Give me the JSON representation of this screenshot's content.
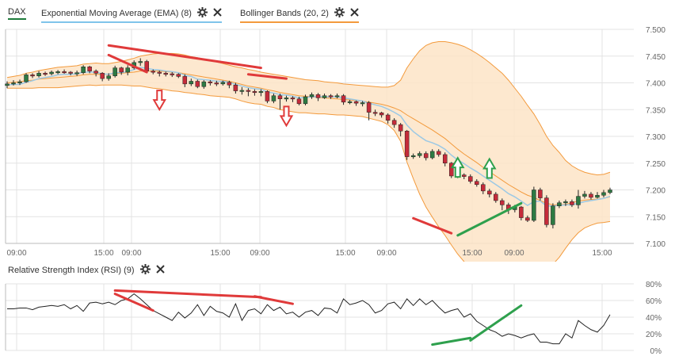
{
  "chart_data": [
    {
      "type": "candlestick",
      "instrument": "DAX",
      "y_ticks": [
        "7.500",
        "7.450",
        "7.400",
        "7.350",
        "7.300",
        "7.250",
        "7.200",
        "7.150",
        "7.100"
      ],
      "ylim": [
        7100,
        7500
      ],
      "x_ticks": [
        "09:00",
        "15:00",
        "09:00",
        "15:00",
        "09:00",
        "15:00",
        "09:00",
        "15:00",
        "09:00",
        "15:00"
      ],
      "grid": true,
      "legend": [
        {
          "label": "DAX",
          "color": "#1e7b3c"
        },
        {
          "label": "Exponential Moving Average (EMA) (8)",
          "color": "#7fc4ea"
        },
        {
          "label": "Bollinger Bands (20, 2)",
          "color": "#f39a3c"
        }
      ],
      "candles": [
        [
          7395,
          7398,
          7390,
          7403
        ],
        [
          7398,
          7400,
          7395,
          7405
        ],
        [
          7400,
          7402,
          7396,
          7406
        ],
        [
          7402,
          7415,
          7400,
          7418
        ],
        [
          7415,
          7413,
          7409,
          7418
        ],
        [
          7413,
          7418,
          7410,
          7422
        ],
        [
          7418,
          7417,
          7413,
          7421
        ],
        [
          7417,
          7420,
          7414,
          7423
        ],
        [
          7420,
          7421,
          7416,
          7424
        ],
        [
          7421,
          7420,
          7417,
          7425
        ],
        [
          7420,
          7418,
          7414,
          7422
        ],
        [
          7418,
          7419,
          7413,
          7423
        ],
        [
          7419,
          7430,
          7416,
          7433
        ],
        [
          7430,
          7422,
          7418,
          7432
        ],
        [
          7422,
          7418,
          7412,
          7425
        ],
        [
          7418,
          7408,
          7403,
          7420
        ],
        [
          7408,
          7413,
          7404,
          7418
        ],
        [
          7413,
          7428,
          7410,
          7432
        ],
        [
          7428,
          7420,
          7415,
          7430
        ],
        [
          7420,
          7428,
          7414,
          7433
        ],
        [
          7428,
          7438,
          7425,
          7442
        ],
        [
          7438,
          7440,
          7432,
          7446
        ],
        [
          7440,
          7422,
          7418,
          7443
        ],
        [
          7422,
          7420,
          7416,
          7425
        ],
        [
          7420,
          7418,
          7412,
          7423
        ],
        [
          7418,
          7417,
          7412,
          7421
        ],
        [
          7417,
          7416,
          7411,
          7420
        ],
        [
          7416,
          7412,
          7409,
          7418
        ],
        [
          7412,
          7398,
          7392,
          7416
        ],
        [
          7398,
          7403,
          7394,
          7408
        ],
        [
          7403,
          7393,
          7390,
          7406
        ],
        [
          7393,
          7402,
          7389,
          7405
        ],
        [
          7402,
          7400,
          7395,
          7405
        ],
        [
          7400,
          7398,
          7394,
          7404
        ],
        [
          7398,
          7401,
          7395,
          7404
        ],
        [
          7401,
          7396,
          7390,
          7404
        ],
        [
          7396,
          7385,
          7380,
          7400
        ],
        [
          7385,
          7386,
          7378,
          7392
        ],
        [
          7386,
          7384,
          7375,
          7390
        ],
        [
          7384,
          7382,
          7376,
          7388
        ],
        [
          7382,
          7384,
          7375,
          7388
        ],
        [
          7384,
          7366,
          7362,
          7386
        ],
        [
          7366,
          7376,
          7362,
          7380
        ],
        [
          7376,
          7370,
          7350,
          7380
        ],
        [
          7370,
          7372,
          7365,
          7376
        ],
        [
          7372,
          7370,
          7364,
          7375
        ],
        [
          7370,
          7361,
          7358,
          7374
        ],
        [
          7361,
          7374,
          7358,
          7378
        ],
        [
          7374,
          7378,
          7370,
          7382
        ],
        [
          7378,
          7372,
          7366,
          7381
        ],
        [
          7372,
          7376,
          7370,
          7380
        ],
        [
          7376,
          7375,
          7370,
          7379
        ],
        [
          7375,
          7376,
          7371,
          7380
        ],
        [
          7376,
          7364,
          7359,
          7379
        ],
        [
          7364,
          7365,
          7360,
          7368
        ],
        [
          7365,
          7362,
          7357,
          7367
        ],
        [
          7362,
          7363,
          7356,
          7366
        ],
        [
          7363,
          7345,
          7330,
          7366
        ],
        [
          7345,
          7344,
          7338,
          7350
        ],
        [
          7344,
          7340,
          7335,
          7346
        ],
        [
          7340,
          7330,
          7324,
          7343
        ],
        [
          7330,
          7322,
          7316,
          7334
        ],
        [
          7322,
          7310,
          7300,
          7325
        ],
        [
          7310,
          7262,
          7256,
          7312
        ],
        [
          7262,
          7264,
          7258,
          7268
        ],
        [
          7264,
          7268,
          7260,
          7272
        ],
        [
          7268,
          7260,
          7255,
          7272
        ],
        [
          7260,
          7272,
          7257,
          7276
        ],
        [
          7272,
          7266,
          7262,
          7276
        ],
        [
          7266,
          7250,
          7244,
          7270
        ],
        [
          7250,
          7226,
          7222,
          7252
        ],
        [
          7226,
          7228,
          7222,
          7232
        ],
        [
          7228,
          7225,
          7220,
          7231
        ],
        [
          7225,
          7216,
          7212,
          7229
        ],
        [
          7216,
          7210,
          7206,
          7220
        ],
        [
          7210,
          7198,
          7192,
          7214
        ],
        [
          7198,
          7192,
          7186,
          7202
        ],
        [
          7192,
          7180,
          7176,
          7196
        ],
        [
          7180,
          7172,
          7162,
          7184
        ],
        [
          7172,
          7163,
          7155,
          7176
        ],
        [
          7163,
          7168,
          7158,
          7172
        ],
        [
          7168,
          7148,
          7143,
          7170
        ],
        [
          7148,
          7143,
          7140,
          7152
        ],
        [
          7143,
          7200,
          7140,
          7206
        ],
        [
          7200,
          7185,
          7180,
          7204
        ],
        [
          7185,
          7135,
          7130,
          7190
        ],
        [
          7135,
          7170,
          7128,
          7175
        ],
        [
          7170,
          7176,
          7166,
          7180
        ],
        [
          7176,
          7178,
          7170,
          7182
        ],
        [
          7178,
          7172,
          7168,
          7182
        ],
        [
          7172,
          7188,
          7165,
          7200
        ],
        [
          7188,
          7192,
          7184,
          7198
        ],
        [
          7192,
          7186,
          7182,
          7196
        ],
        [
          7186,
          7190,
          7184,
          7196
        ],
        [
          7190,
          7195,
          7186,
          7200
        ],
        [
          7195,
          7200,
          7192,
          7204
        ]
      ],
      "ema_8": [
        7396,
        7397,
        7397,
        7401,
        7404,
        7408,
        7410,
        7412,
        7415,
        7416,
        7416,
        7417,
        7420,
        7420,
        7420,
        7417,
        7416,
        7419,
        7419,
        7421,
        7425,
        7429,
        7427,
        7425,
        7424,
        7422,
        7421,
        7419,
        7414,
        7412,
        7407,
        7406,
        7405,
        7403,
        7403,
        7401,
        7397,
        7394,
        7391,
        7389,
        7388,
        7383,
        7381,
        7378,
        7377,
        7375,
        7372,
        7373,
        7374,
        7374,
        7374,
        7374,
        7374,
        7372,
        7370,
        7368,
        7366,
        7362,
        7359,
        7356,
        7351,
        7345,
        7338,
        7321,
        7309,
        7300,
        7292,
        7288,
        7283,
        7276,
        7265,
        7256,
        7249,
        7241,
        7234,
        7226,
        7218,
        7210,
        7202,
        7193,
        7187,
        7179,
        7171,
        7178,
        7179,
        7170,
        7170,
        7171,
        7172,
        7172,
        7175,
        7178,
        7180,
        7182,
        7184,
        7188
      ],
      "bollinger_mid": [
        7400,
        7401,
        7402,
        7404,
        7405,
        7407,
        7408,
        7409,
        7410,
        7411,
        7412,
        7413,
        7415,
        7416,
        7416,
        7416,
        7416,
        7417,
        7418,
        7419,
        7420,
        7422,
        7422,
        7422,
        7422,
        7421,
        7420,
        7419,
        7417,
        7415,
        7413,
        7411,
        7409,
        7407,
        7405,
        7403,
        7400,
        7397,
        7394,
        7392,
        7390,
        7387,
        7385,
        7382,
        7380,
        7378,
        7376,
        7375,
        7374,
        7373,
        7372,
        7371,
        7370,
        7369,
        7368,
        7367,
        7366,
        7364,
        7362,
        7360,
        7357,
        7353,
        7348,
        7340,
        7333,
        7326,
        7319,
        7312,
        7304,
        7296,
        7286,
        7276,
        7267,
        7259,
        7251,
        7242,
        7234,
        7226,
        7218,
        7210,
        7203,
        7196,
        7190,
        7186,
        7180,
        7175,
        7172,
        7172,
        7173,
        7176,
        7179,
        7181,
        7182,
        7183,
        7184,
        7187
      ],
      "bollinger_upper": [
        7410,
        7412,
        7414,
        7418,
        7420,
        7423,
        7425,
        7427,
        7429,
        7430,
        7431,
        7432,
        7435,
        7436,
        7437,
        7436,
        7436,
        7438,
        7440,
        7443,
        7446,
        7450,
        7452,
        7454,
        7455,
        7455,
        7455,
        7454,
        7452,
        7449,
        7447,
        7444,
        7442,
        7439,
        7436,
        7433,
        7430,
        7428,
        7425,
        7423,
        7420,
        7418,
        7416,
        7414,
        7412,
        7410,
        7408,
        7406,
        7405,
        7404,
        7402,
        7401,
        7400,
        7398,
        7397,
        7396,
        7395,
        7394,
        7393,
        7392,
        7392,
        7395,
        7405,
        7428,
        7445,
        7460,
        7470,
        7475,
        7477,
        7477,
        7475,
        7472,
        7468,
        7462,
        7455,
        7447,
        7438,
        7428,
        7418,
        7405,
        7390,
        7375,
        7358,
        7342,
        7322,
        7300,
        7283,
        7270,
        7255,
        7245,
        7238,
        7233,
        7230,
        7228,
        7229,
        7233
      ],
      "bollinger_lower": [
        7390,
        7390,
        7390,
        7390,
        7390,
        7391,
        7391,
        7391,
        7391,
        7392,
        7393,
        7394,
        7395,
        7396,
        7395,
        7396,
        7396,
        7396,
        7396,
        7395,
        7394,
        7394,
        7392,
        7390,
        7389,
        7387,
        7385,
        7384,
        7382,
        7381,
        7379,
        7378,
        7376,
        7375,
        7374,
        7373,
        7370,
        7366,
        7363,
        7361,
        7360,
        7356,
        7354,
        7350,
        7348,
        7346,
        7344,
        7344,
        7343,
        7342,
        7342,
        7341,
        7340,
        7340,
        7339,
        7338,
        7337,
        7334,
        7331,
        7328,
        7322,
        7311,
        7291,
        7252,
        7221,
        7192,
        7168,
        7149,
        7131,
        7115,
        7097,
        7080,
        7066,
        7056,
        7047,
        7037,
        7030,
        7024,
        7018,
        7015,
        7016,
        7017,
        7022,
        7030,
        7038,
        7050,
        7061,
        7074,
        7091,
        7107,
        7120,
        7129,
        7134,
        7138,
        7139,
        7141
      ],
      "annotations": {
        "trendlines_price": [
          {
            "from": [
              16,
              7470
            ],
            "to": [
              40,
              7428
            ],
            "color": "#e03a3a"
          },
          {
            "from": [
              16,
              7452
            ],
            "to": [
              22,
              7420
            ],
            "color": "#e03a3a"
          },
          {
            "from": [
              38,
              7416
            ],
            "to": [
              44,
              7408
            ],
            "color": "#e03a3a"
          },
          {
            "from": [
              64,
              7147
            ],
            "to": [
              70,
              7119
            ],
            "color": "#e03a3a"
          },
          {
            "from": [
              71,
              7115
            ],
            "to": [
              81,
              7175
            ],
            "color": "#2ea04d"
          }
        ],
        "arrows": [
          {
            "index": 24,
            "price": 7365,
            "direction": "down",
            "color": "#e03a3a"
          },
          {
            "index": 44,
            "price": 7335,
            "direction": "down",
            "color": "#e03a3a"
          },
          {
            "index": 71,
            "price": 7245,
            "direction": "up",
            "color": "#2ea04d"
          },
          {
            "index": 76,
            "price": 7243,
            "direction": "up",
            "color": "#2ea04d"
          }
        ]
      }
    },
    {
      "type": "line",
      "title": "Relative Strength Index (RSI) (9)",
      "y_ticks": [
        "80%",
        "60%",
        "40%",
        "20%",
        "0%"
      ],
      "ylim": [
        0,
        80
      ],
      "grid": true,
      "color": "#222222",
      "values": [
        50,
        50,
        51,
        51,
        49,
        52,
        53,
        54,
        53,
        55,
        50,
        54,
        47,
        57,
        58,
        56,
        58,
        55,
        60,
        62,
        68,
        62,
        55,
        48,
        44,
        40,
        36,
        46,
        39,
        45,
        55,
        42,
        53,
        47,
        45,
        40,
        56,
        36,
        48,
        50,
        44,
        55,
        48,
        52,
        44,
        46,
        40,
        46,
        48,
        42,
        51,
        50,
        45,
        62,
        55,
        57,
        60,
        55,
        45,
        48,
        56,
        58,
        50,
        62,
        54,
        62,
        55,
        60,
        52,
        45,
        48,
        50,
        40,
        44,
        35,
        30,
        25,
        22,
        17,
        20,
        18,
        15,
        18,
        20,
        10,
        10,
        8,
        8,
        20,
        15,
        36,
        30,
        25,
        22,
        30,
        43
      ],
      "annotations": {
        "trendlines_rsi": [
          {
            "from": [
              17,
              72
            ],
            "to": [
              40,
              64
            ],
            "color": "#e03a3a"
          },
          {
            "from": [
              17,
              68
            ],
            "to": [
              23,
              48
            ],
            "color": "#e03a3a"
          },
          {
            "from": [
              39,
              65
            ],
            "to": [
              45,
              56
            ],
            "color": "#e03a3a"
          },
          {
            "from": [
              67,
              7
            ],
            "to": [
              73,
              15
            ],
            "color": "#2ea04d"
          },
          {
            "from": [
              73,
              12
            ],
            "to": [
              81,
              54
            ],
            "color": "#2ea04d"
          }
        ]
      }
    }
  ],
  "legend_items": {
    "dax": "DAX",
    "ema": "Exponential Moving Average (EMA) (8)",
    "bb": "Bollinger Bands (20, 2)",
    "rsi": "Relative Strength Index (RSI) (9)"
  },
  "controls": {
    "settings_icon": "gear-icon",
    "close_icon": "close-icon"
  },
  "colors": {
    "up_candle": "#2d7a43",
    "down_candle": "#c52b3a",
    "band_fill": "#fde4c7",
    "band_line": "#f39a3c",
    "ema_line": "#9cc9e5",
    "grid": "#e3e3e3",
    "red_marker": "#e03a3a",
    "green_marker": "#2ea04d"
  }
}
